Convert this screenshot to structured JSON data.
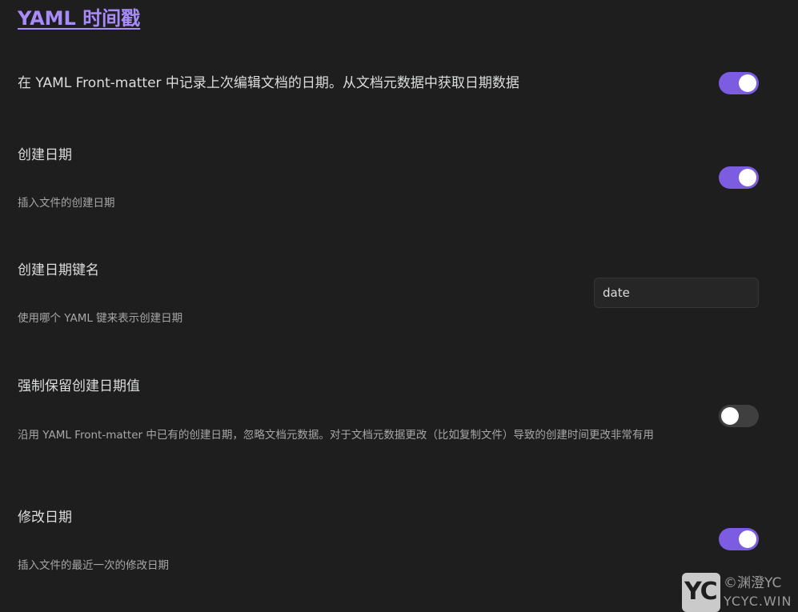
{
  "section": {
    "title": "YAML 时间戳"
  },
  "settings": [
    {
      "name": "在 YAML Front-matter 中记录上次编辑文档的日期。从文档元数据中获取日期数据",
      "description": "",
      "control": "toggle",
      "enabled": true
    },
    {
      "name": "创建日期",
      "description": "插入文件的创建日期",
      "control": "toggle",
      "enabled": true
    },
    {
      "name": "创建日期键名",
      "description": "使用哪个 YAML 键来表示创建日期",
      "control": "text",
      "value": "date",
      "placeholder": ""
    },
    {
      "name": "强制保留创建日期值",
      "description": "沿用 YAML Front-matter 中已有的创建日期，忽略文档元数据。对于文档元数据更改（比如复制文件）导致的创建时间更改非常有用",
      "control": "toggle",
      "enabled": false
    },
    {
      "name": "修改日期",
      "description": "插入文件的最近一次的修改日期",
      "control": "toggle",
      "enabled": true
    }
  ],
  "watermark": {
    "logo_text": "YC",
    "line1": "©渊澄YC",
    "line2": "YCYC.WIN"
  },
  "colors": {
    "background": "#1e1e1e",
    "accent": "#7c5ce0",
    "title_link": "#a88bfa",
    "toggle_off": "#3f3f3f"
  }
}
